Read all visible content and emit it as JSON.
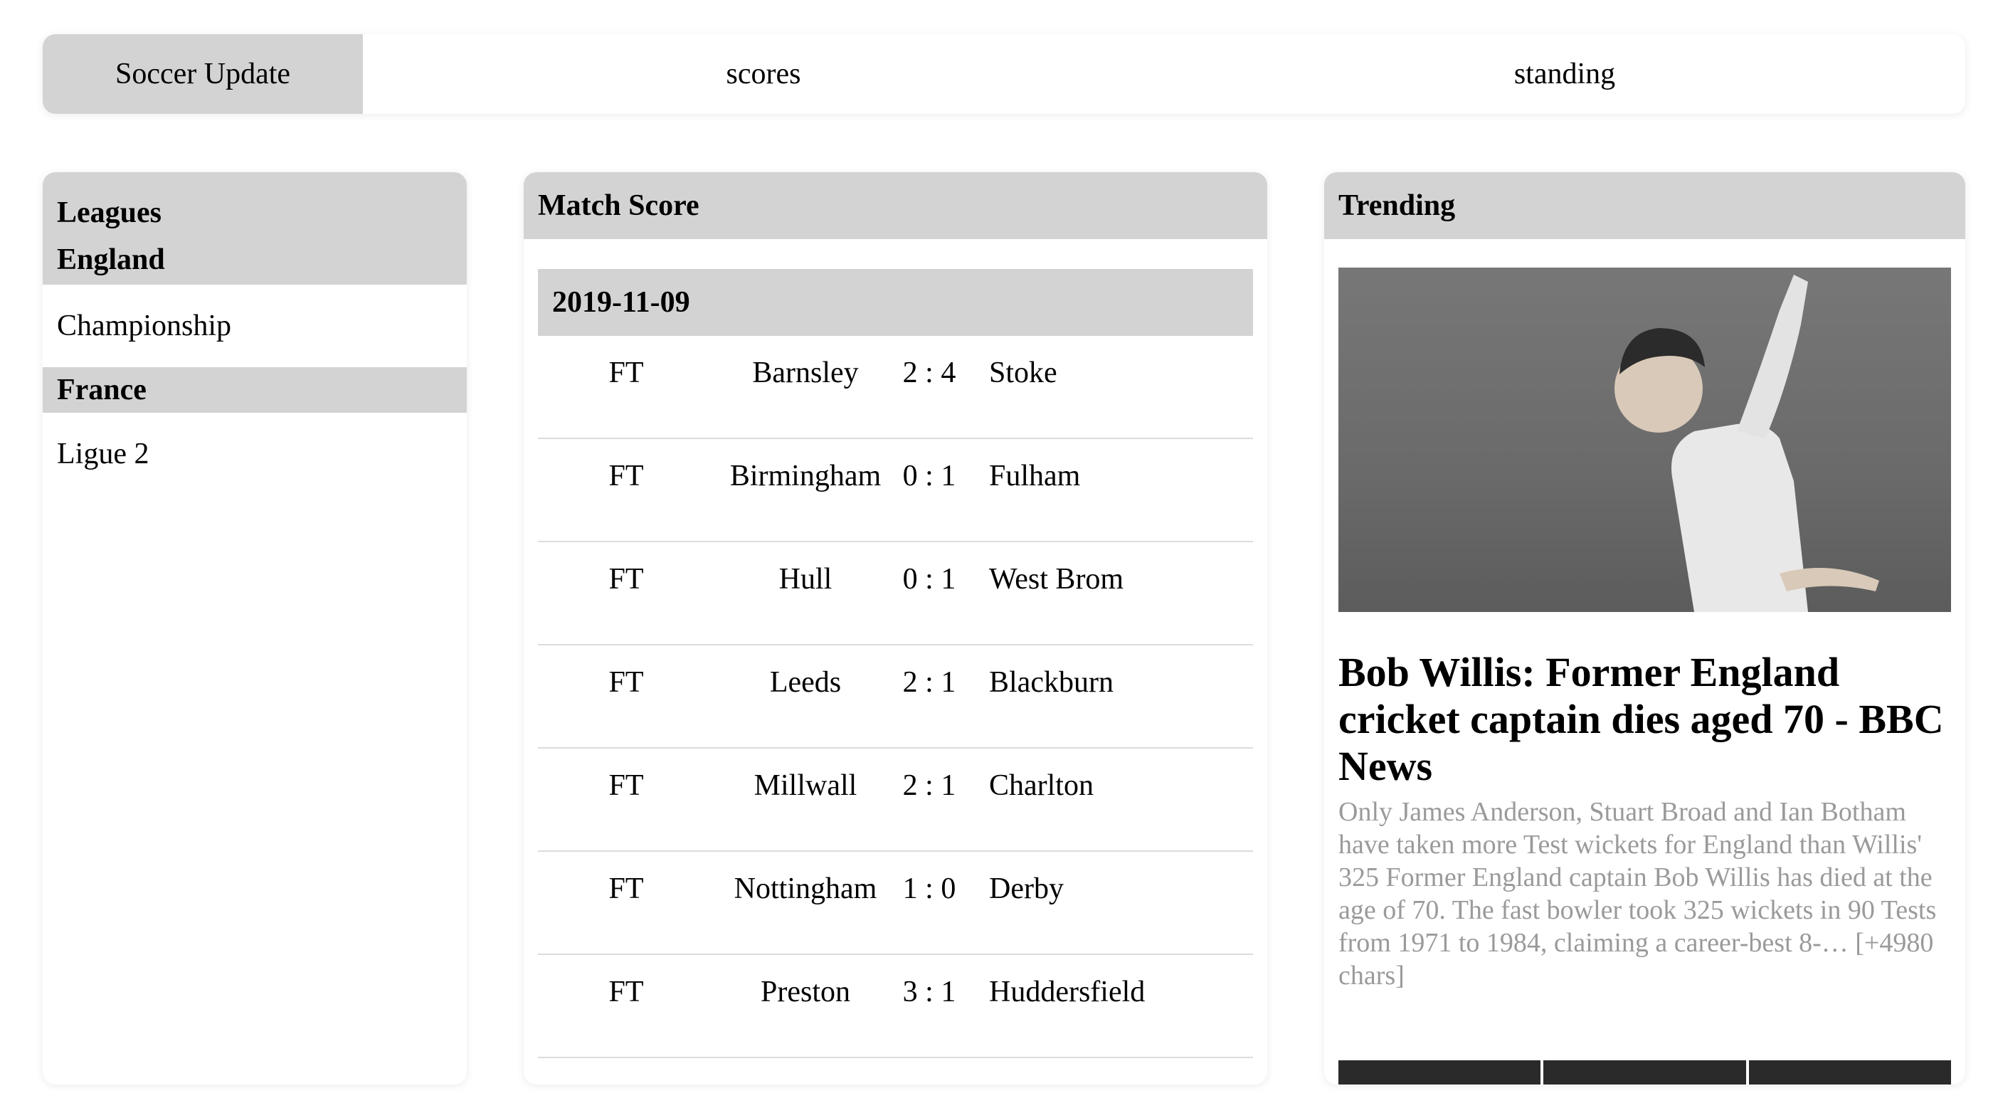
{
  "nav": {
    "brand": "Soccer Update",
    "links": [
      "scores",
      "standing"
    ]
  },
  "leagues": {
    "title": "Leagues",
    "countries": [
      {
        "name": "England",
        "leagues": [
          "Championship"
        ]
      },
      {
        "name": "France",
        "leagues": [
          "Ligue 2"
        ]
      }
    ]
  },
  "scores": {
    "title": "Match Score",
    "date": "2019-11-09",
    "matches": [
      {
        "status": "FT",
        "home": "Barnsley",
        "score": "2 : 4",
        "away": "Stoke"
      },
      {
        "status": "FT",
        "home": "Birmingham",
        "score": "0 : 1",
        "away": "Fulham"
      },
      {
        "status": "FT",
        "home": "Hull",
        "score": "0 : 1",
        "away": "West Brom"
      },
      {
        "status": "FT",
        "home": "Leeds",
        "score": "2 : 1",
        "away": "Blackburn"
      },
      {
        "status": "FT",
        "home": "Millwall",
        "score": "2 : 1",
        "away": "Charlton"
      },
      {
        "status": "FT",
        "home": "Nottingham",
        "score": "1 : 0",
        "away": "Derby"
      },
      {
        "status": "FT",
        "home": "Preston",
        "score": "3 : 1",
        "away": "Huddersfield"
      }
    ]
  },
  "trending": {
    "title": "Trending",
    "article": {
      "headline": "Bob Willis: Former England cricket captain dies aged 70 - BBC News",
      "description": "Only James Anderson, Stuart Broad and Ian Botham have taken more Test wickets for England than Willis' 325 Former England captain Bob Willis has died at the age of 70. The fast bowler took 325 wickets in 90 Tests from 1971 to 1984, claiming a career-best 8-… [+4980 chars]"
    }
  }
}
